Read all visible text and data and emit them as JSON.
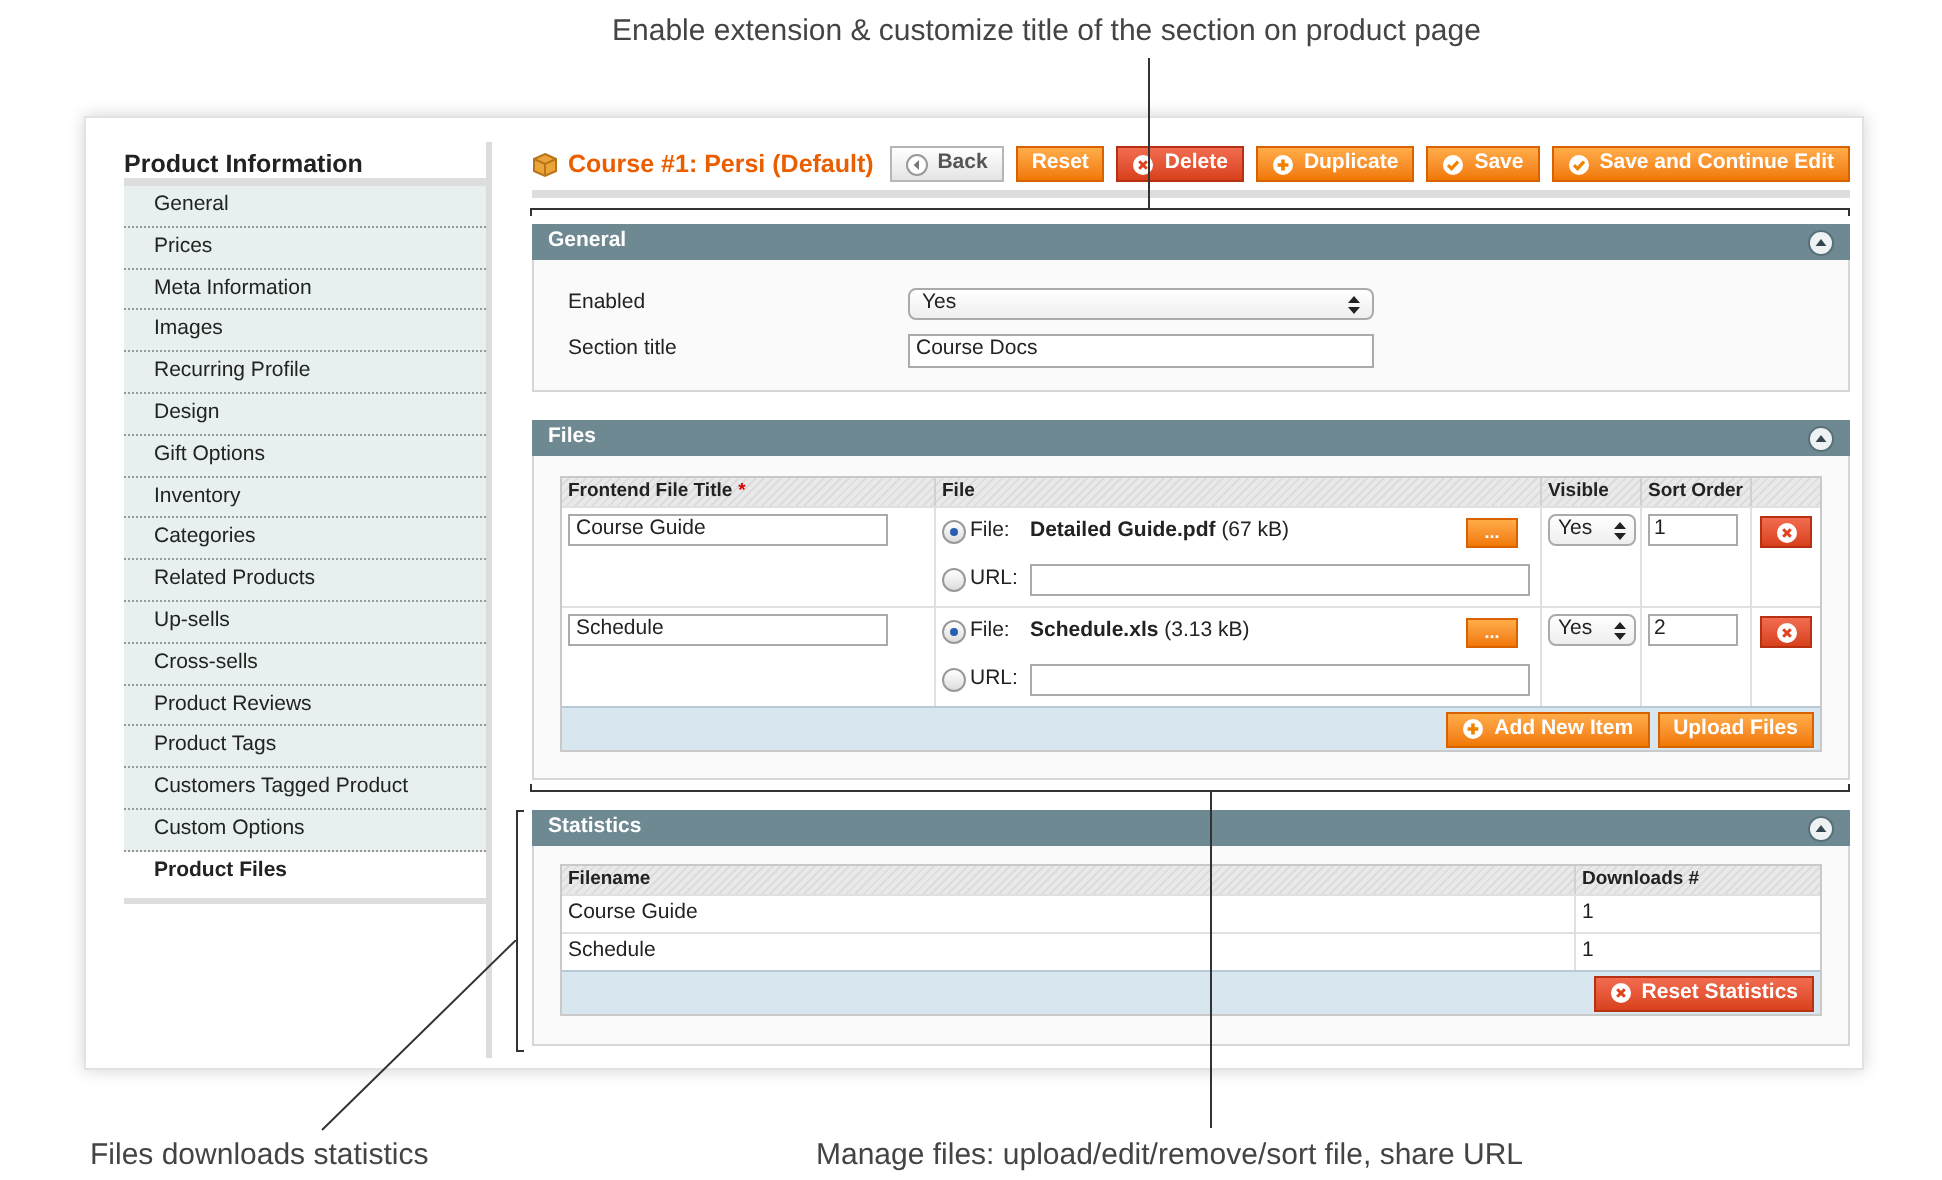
{
  "annotations": {
    "top": "Enable extension & customize title of the section on product page",
    "bottom_left": "Files downloads statistics",
    "bottom_right": "Manage files: upload/edit/remove/sort file, share URL"
  },
  "sidebar": {
    "title": "Product Information",
    "items": [
      {
        "label": "General",
        "selected": false
      },
      {
        "label": "Prices",
        "selected": false
      },
      {
        "label": "Meta Information",
        "selected": false
      },
      {
        "label": "Images",
        "selected": false
      },
      {
        "label": "Recurring Profile",
        "selected": false
      },
      {
        "label": "Design",
        "selected": false
      },
      {
        "label": "Gift Options",
        "selected": false
      },
      {
        "label": "Inventory",
        "selected": false
      },
      {
        "label": "Categories",
        "selected": false
      },
      {
        "label": "Related Products",
        "selected": false
      },
      {
        "label": "Up-sells",
        "selected": false
      },
      {
        "label": "Cross-sells",
        "selected": false
      },
      {
        "label": "Product Reviews",
        "selected": false
      },
      {
        "label": "Product Tags",
        "selected": false
      },
      {
        "label": "Customers Tagged Product",
        "selected": false
      },
      {
        "label": "Custom Options",
        "selected": false
      },
      {
        "label": "Product Files",
        "selected": true
      }
    ]
  },
  "header": {
    "title": "Course #1: Persi (Default)",
    "buttons": [
      {
        "label": "Back",
        "kind": "back"
      },
      {
        "label": "Reset",
        "kind": "plain"
      },
      {
        "label": "Delete",
        "kind": "delete"
      },
      {
        "label": "Duplicate",
        "kind": "add"
      },
      {
        "label": "Save",
        "kind": "check"
      },
      {
        "label": "Save and Continue Edit",
        "kind": "check"
      }
    ]
  },
  "general": {
    "title": "General",
    "fields": [
      {
        "label": "Enabled",
        "kind": "select",
        "value": "Yes"
      },
      {
        "label": "Section title",
        "kind": "text",
        "value": "Course Docs"
      }
    ]
  },
  "files": {
    "title": "Files",
    "columns": [
      {
        "label": "Frontend File Title",
        "required_mark": "*"
      },
      {
        "label": "File"
      },
      {
        "label": "Visible"
      },
      {
        "label": "Sort Order"
      }
    ],
    "rows": [
      {
        "title": "Course Guide",
        "file_option": {
          "label": "File:",
          "selected": true
        },
        "file_name": "Detailed Guide.pdf",
        "file_size": "(67 kB)",
        "browse": "...",
        "url_option": {
          "label": "URL:",
          "selected": false
        },
        "visible": "Yes",
        "sort_order": "1"
      },
      {
        "title": "Schedule",
        "file_option": {
          "label": "File:",
          "selected": true
        },
        "file_name": "Schedule.xls",
        "file_size": "(3.13 kB)",
        "browse": "...",
        "url_option": {
          "label": "URL:",
          "selected": false
        },
        "visible": "Yes",
        "sort_order": "2"
      }
    ],
    "buttons": [
      {
        "label": "Add New Item",
        "kind": "add"
      },
      {
        "label": "Upload Files",
        "kind": "plain"
      }
    ]
  },
  "statistics": {
    "title": "Statistics",
    "columns": [
      "Filename",
      "Downloads #"
    ],
    "rows": [
      {
        "filename": "Course Guide",
        "downloads": "1"
      },
      {
        "filename": "Schedule",
        "downloads": "1"
      }
    ],
    "button": {
      "label": "Reset Statistics",
      "kind": "delete"
    }
  }
}
